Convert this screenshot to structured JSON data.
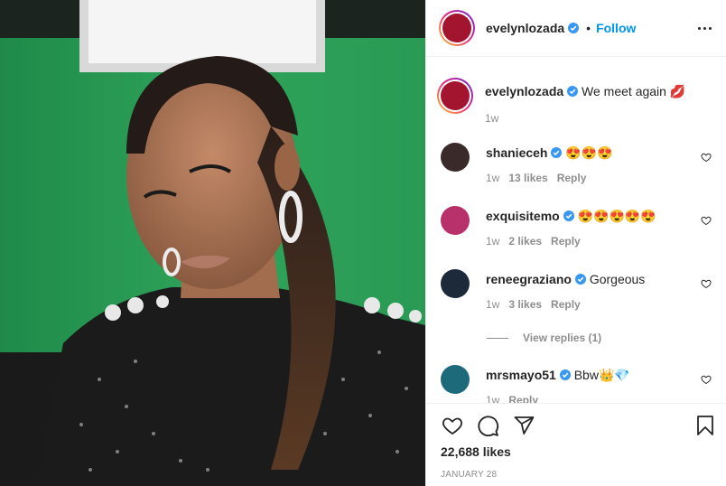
{
  "post": {
    "author": "evelynlozada",
    "follow_label": "Follow",
    "separator": "•",
    "caption_author": "evelynlozada",
    "caption_text": "We meet again 💋",
    "caption_time": "1w",
    "likes": "22,688 likes",
    "date": "JANUARY 28"
  },
  "comments": [
    {
      "user": "shanieceh",
      "text": "😍😍😍",
      "time": "1w",
      "likes": "13 likes",
      "reply": "Reply",
      "avatar_color": "#3a2a2a"
    },
    {
      "user": "exquisitemo",
      "text": "😍😍😍😍😍",
      "time": "1w",
      "likes": "2 likes",
      "reply": "Reply",
      "avatar_color": "#b8316a"
    },
    {
      "user": "reneegraziano",
      "text": "Gorgeous",
      "time": "1w",
      "likes": "3 likes",
      "reply": "Reply",
      "avatar_color": "#1d2a3a"
    },
    {
      "user": "mrsmayo51",
      "text": "Bbw👑💎",
      "time": "1w",
      "likes": "",
      "reply": "Reply",
      "avatar_color": "#1d6b7a"
    }
  ],
  "view_replies": "View replies (1)",
  "icons": {
    "like": "heart-icon",
    "comment": "comment-icon",
    "share": "share-icon",
    "save": "bookmark-icon",
    "more": "more-options-icon"
  },
  "colors": {
    "link": "#0095f6",
    "secondary_text": "#8e8e8e",
    "green_screen": "#2a9a55"
  }
}
